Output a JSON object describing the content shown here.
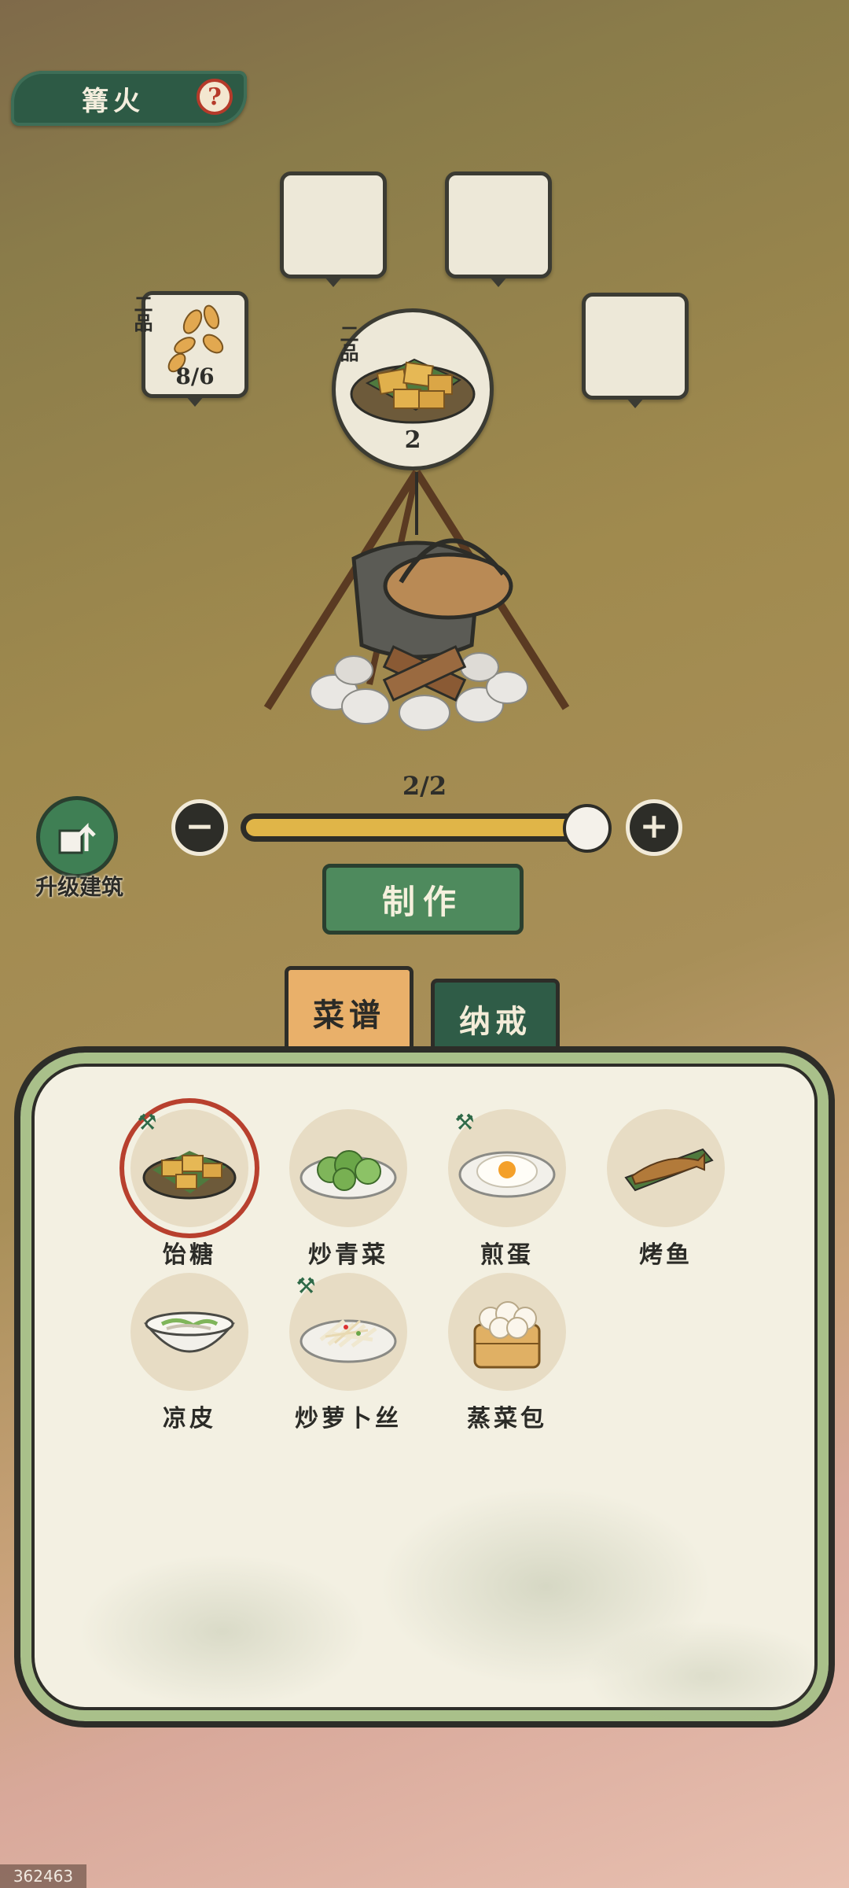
{
  "header": {
    "title": "篝火",
    "help_symbol": "?"
  },
  "ingredients": [
    {
      "grade": "二品",
      "amount": "8/6",
      "icon": "seeds-icon"
    },
    {
      "grade": "",
      "amount": "",
      "icon": ""
    },
    {
      "grade": "",
      "amount": "",
      "icon": ""
    },
    {
      "grade": "",
      "amount": "",
      "icon": ""
    }
  ],
  "product": {
    "grade": "二品",
    "count": "2",
    "icon": "candy-plate-icon"
  },
  "craft": {
    "count_label": "2/2",
    "minus_symbol": "−",
    "plus_symbol": "+",
    "progress": 1.0,
    "make_label": "制作"
  },
  "upgrade": {
    "label": "升级建筑"
  },
  "tabs": [
    {
      "label": "菜谱",
      "active": true
    },
    {
      "label": "纳戒",
      "active": false
    }
  ],
  "recipes": [
    {
      "name": "饴糖",
      "icon": "candy-icon",
      "selected": true,
      "hammer": true
    },
    {
      "name": "炒青菜",
      "icon": "greens-icon",
      "selected": false,
      "hammer": false
    },
    {
      "name": "煎蛋",
      "icon": "fried-egg-icon",
      "selected": false,
      "hammer": true
    },
    {
      "name": "烤鱼",
      "icon": "grilled-fish-icon",
      "selected": false,
      "hammer": false
    },
    {
      "name": "凉皮",
      "icon": "noodle-bowl-icon",
      "selected": false,
      "hammer": false
    },
    {
      "name": "炒萝卜丝",
      "icon": "radish-strips-icon",
      "selected": false,
      "hammer": true
    },
    {
      "name": "蒸菜包",
      "icon": "steamed-buns-icon",
      "selected": false,
      "hammer": false
    }
  ],
  "watermark": "362463",
  "colors": {
    "accent_green": "#4e8a5d",
    "dark_green": "#2f5c47",
    "tab_orange": "#e9b06a",
    "selected_ring": "#b8402e",
    "slider_fill": "#e0b548"
  }
}
